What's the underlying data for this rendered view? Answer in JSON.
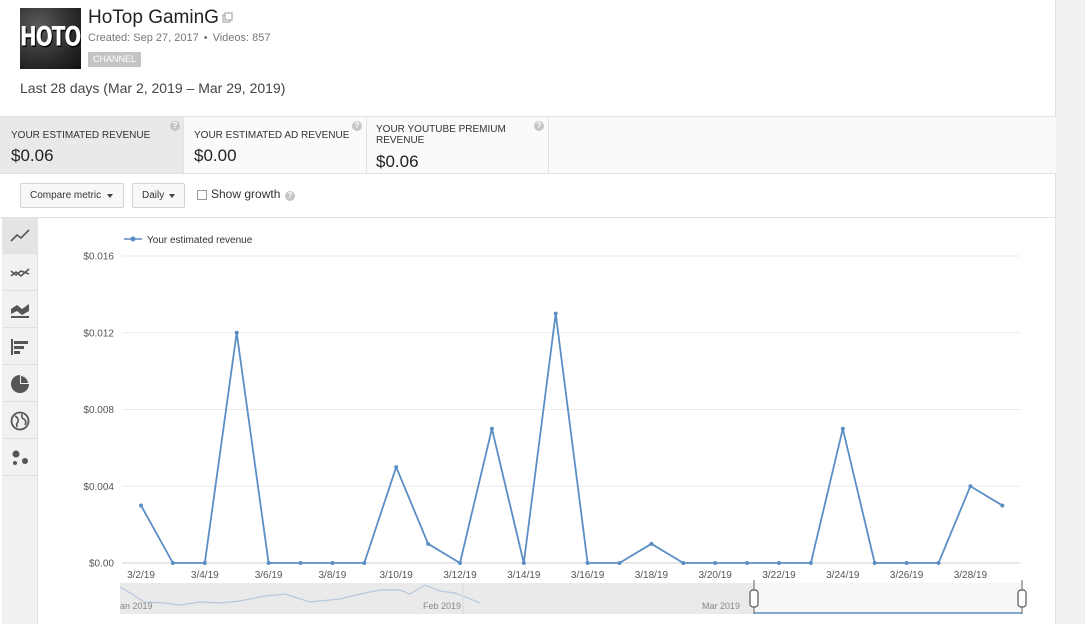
{
  "channel": {
    "name": "HoTop GaminG",
    "avatar_text": "HOTOP",
    "created": "Created: Sep 27, 2017",
    "meta_sep": "•",
    "videos": "Videos: 857",
    "badge": "CHANNEL"
  },
  "date_range": "Last 28 days (Mar 2, 2019 – Mar 29, 2019)",
  "metrics": [
    {
      "label": "YOUR ESTIMATED REVENUE",
      "value": "$0.06",
      "active": true
    },
    {
      "label": "YOUR ESTIMATED AD REVENUE",
      "value": "$0.00",
      "active": false
    },
    {
      "label": "YOUR YOUTUBE PREMIUM REVENUE",
      "label_line1": "YOUR YOUTUBE PREMIUM",
      "label_line2": "REVENUE",
      "value": "$0.06",
      "active": false
    }
  ],
  "help_glyph": "?",
  "toolbar": {
    "compare_metric": "Compare metric",
    "granularity": "Daily",
    "show_growth": "Show growth",
    "show_growth_checked": false
  },
  "rail_icons": [
    "line-chart-icon",
    "multi-line-icon",
    "stacked-area-icon",
    "bar-chart-icon",
    "pie-chart-icon",
    "globe-map-icon",
    "bubble-chart-icon"
  ],
  "colors": {
    "series": "#5b8ec5",
    "grid": "#ebebeb",
    "axis_text": "#555555",
    "active_tab": "#e9e9e9"
  },
  "chart_data": {
    "type": "line",
    "legend": "Your estimated revenue",
    "legend_position": "top-left",
    "x": [
      "3/2/19",
      "3/3/19",
      "3/4/19",
      "3/5/19",
      "3/6/19",
      "3/7/19",
      "3/8/19",
      "3/9/19",
      "3/10/19",
      "3/11/19",
      "3/12/19",
      "3/13/19",
      "3/14/19",
      "3/15/19",
      "3/16/19",
      "3/17/19",
      "3/18/19",
      "3/19/19",
      "3/20/19",
      "3/21/19",
      "3/22/19",
      "3/23/19",
      "3/24/19",
      "3/25/19",
      "3/26/19",
      "3/27/19",
      "3/28/19",
      "3/29/19"
    ],
    "x_tick_labels": [
      "3/2/19",
      "3/4/19",
      "3/6/19",
      "3/8/19",
      "3/10/19",
      "3/12/19",
      "3/14/19",
      "3/16/19",
      "3/18/19",
      "3/20/19",
      "3/22/19",
      "3/24/19",
      "3/26/19",
      "3/28/19"
    ],
    "series": [
      {
        "name": "Your estimated revenue",
        "values": [
          0.003,
          0,
          0,
          0.012,
          0,
          0,
          0,
          0,
          0.005,
          0.001,
          0,
          0.007,
          0,
          0.013,
          0,
          0,
          0.001,
          0,
          0,
          0,
          0,
          0,
          0.007,
          0,
          0,
          0,
          0.004,
          0.003
        ]
      }
    ],
    "y_ticks": [
      "$0.00",
      "$0.004",
      "$0.008",
      "$0.012",
      "$0.016"
    ],
    "y_tick_values": [
      0,
      0.004,
      0.008,
      0.012,
      0.016
    ],
    "ylim": [
      0,
      0.016
    ],
    "grid": true
  },
  "overview": {
    "labels": [
      "an 2019",
      "Feb 2019",
      "Mar 2019"
    ]
  }
}
